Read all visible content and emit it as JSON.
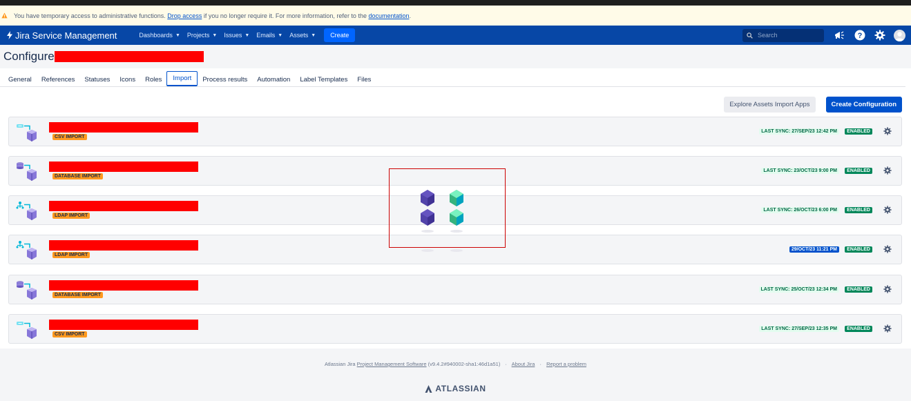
{
  "warning": {
    "text_before": "You have temporary access to administrative functions.",
    "drop_link": "Drop access",
    "text_middle": "if you no longer require it. For more information, refer to the",
    "doc_link": "documentation",
    "text_end": "."
  },
  "nav": {
    "brand": "Jira Service Management",
    "items": [
      {
        "label": "Dashboards"
      },
      {
        "label": "Projects"
      },
      {
        "label": "Issues"
      },
      {
        "label": "Emails"
      },
      {
        "label": "Assets"
      }
    ],
    "create": "Create",
    "search_placeholder": "Search"
  },
  "page": {
    "title": "Configure"
  },
  "tabs": [
    {
      "label": "General"
    },
    {
      "label": "References"
    },
    {
      "label": "Statuses"
    },
    {
      "label": "Icons"
    },
    {
      "label": "Roles"
    },
    {
      "label": "Import"
    },
    {
      "label": "Process results"
    },
    {
      "label": "Automation"
    },
    {
      "label": "Label Templates"
    },
    {
      "label": "Files"
    }
  ],
  "active_tab": "Import",
  "actions": {
    "explore": "Explore Assets Import Apps",
    "create_config": "Create Configuration"
  },
  "imports": [
    {
      "type_label": "CSV IMPORT",
      "icon": "csv-import-icon",
      "sync": "LAST SYNC: 27/SEP/23 12:42 PM",
      "status": "ENABLED"
    },
    {
      "type_label": "DATABASE IMPORT",
      "icon": "database-import-icon",
      "sync": "LAST SYNC: 23/OCT/23 9:00 PM",
      "status": "ENABLED"
    },
    {
      "type_label": "LDAP IMPORT",
      "icon": "ldap-import-icon",
      "sync": "LAST SYNC: 26/OCT/23 6:00 PM",
      "status": "ENABLED"
    },
    {
      "type_label": "LDAP IMPORT",
      "icon": "ldap-import-icon",
      "sync": "29/OCT/23 11:21 PM",
      "status": "ENABLED"
    },
    {
      "type_label": "DATABASE IMPORT",
      "icon": "database-import-icon",
      "sync": "LAST SYNC: 25/OCT/23 12:34 PM",
      "status": "ENABLED"
    },
    {
      "type_label": "CSV IMPORT",
      "icon": "csv-import-icon",
      "sync": "LAST SYNC: 27/SEP/23 12:35 PM",
      "status": "ENABLED"
    }
  ],
  "footer": {
    "prefix": "Atlassian Jira",
    "pms_link": "Project Management Software",
    "version": "(v9.4.2#940002-sha1:46d1a51)",
    "about": "About Jira",
    "report": "Report a problem",
    "brand": "ATLASSIAN"
  },
  "colors": {
    "nav_bg": "#0747a6",
    "primary": "#0052cc",
    "tag_orange": "#ff991f",
    "enabled_green": "#00875a",
    "redaction": "#ff0000"
  }
}
